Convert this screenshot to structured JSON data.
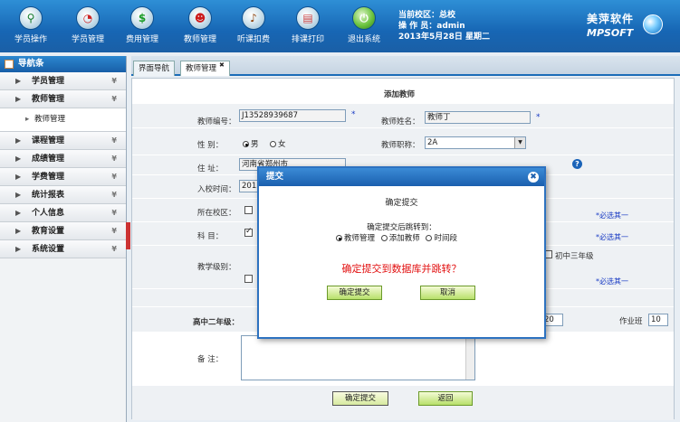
{
  "toolbar": {
    "items": [
      {
        "label": "学员操作",
        "icon": "search-icon",
        "glyph": "🔍"
      },
      {
        "label": "学员管理",
        "icon": "student-icon",
        "glyph": "⚙"
      },
      {
        "label": "费用管理",
        "icon": "money-icon",
        "glyph": "$"
      },
      {
        "label": "教师管理",
        "icon": "teacher-icon",
        "glyph": "☻"
      },
      {
        "label": "听课扣费",
        "icon": "ear-icon",
        "glyph": "♪"
      },
      {
        "label": "排课打印",
        "icon": "print-icon",
        "glyph": "▤"
      },
      {
        "label": "退出系统",
        "icon": "power-icon",
        "glyph": "⏻"
      }
    ]
  },
  "sysinfo": {
    "campus": "当前校区：总校",
    "operator": "操 作 员：admin",
    "date": "2013年5月28日 星期二"
  },
  "logo": {
    "cn": "美萍软件",
    "en": "MPSOFT"
  },
  "sidebar": {
    "title": "导航条",
    "items": [
      {
        "label": "学员管理"
      },
      {
        "label": "教师管理"
      },
      {
        "label": "课程管理"
      },
      {
        "label": "成绩管理"
      },
      {
        "label": "学费管理"
      },
      {
        "label": "统计报表"
      },
      {
        "label": "个人信息"
      },
      {
        "label": "教育设置"
      },
      {
        "label": "系统设置"
      }
    ],
    "subitem": "教师管理"
  },
  "tabs": [
    {
      "label": "界面导航"
    },
    {
      "label": "教师管理"
    }
  ],
  "form": {
    "title": "添加教师",
    "teacher_no_label": "教师编号：",
    "teacher_no": "J13528939687",
    "teacher_name_label": "教师姓名：",
    "teacher_name": "教师丁",
    "gender_label": "性    别：",
    "gender_male": "男",
    "gender_female": "女",
    "title_label": "教师职称：",
    "title_value": "2A",
    "address_label": "住    址：",
    "address_value": "河南省郑州市",
    "join_label": "入校时间：",
    "join_value": "2013",
    "campus_label": "所在校区：",
    "subject_label": "科    目：",
    "level_label": "教学级别：",
    "required_note": "*必选其一",
    "junior3": "初中三年级",
    "senior2_label": "高中二年级：",
    "hours_value": "20",
    "homework_label": "作业班",
    "homework_value": "10",
    "remark_label": "备    注：",
    "confirm_button": "确定提交",
    "back_button": "返回"
  },
  "modal": {
    "title": "提交",
    "heading": "确定提交",
    "jump_label": "确定提交后跳转到：",
    "options": [
      "教师管理",
      "添加教师",
      "时间段"
    ],
    "question": "确定提交到数据库并跳转？",
    "confirm": "确定提交",
    "cancel": "取消"
  }
}
